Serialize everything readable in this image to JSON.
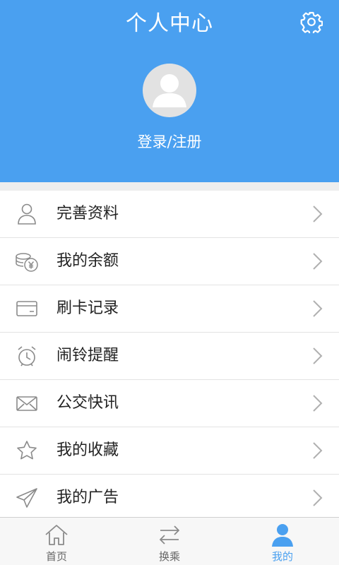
{
  "header": {
    "title": "个人中心",
    "login_label": "登录/注册",
    "background": "#4aa0f0",
    "settings_icon": "gear-icon",
    "avatar_icon": "user-avatar-icon"
  },
  "menu": {
    "items": [
      {
        "label": "完善资料",
        "icon": "user-profile-icon"
      },
      {
        "label": "我的余额",
        "icon": "coins-yen-icon"
      },
      {
        "label": "刷卡记录",
        "icon": "card-icon"
      },
      {
        "label": "闹铃提醒",
        "icon": "alarm-clock-icon"
      },
      {
        "label": "公交快讯",
        "icon": "envelope-icon"
      },
      {
        "label": "我的收藏",
        "icon": "star-icon"
      },
      {
        "label": "我的广告",
        "icon": "paper-plane-icon"
      }
    ]
  },
  "tabbar": {
    "tabs": [
      {
        "label": "首页",
        "icon": "home-icon",
        "active": false
      },
      {
        "label": "换乘",
        "icon": "transfer-icon",
        "active": false
      },
      {
        "label": "我的",
        "icon": "user-icon",
        "active": true
      }
    ],
    "active_color": "#4aa0f0"
  }
}
